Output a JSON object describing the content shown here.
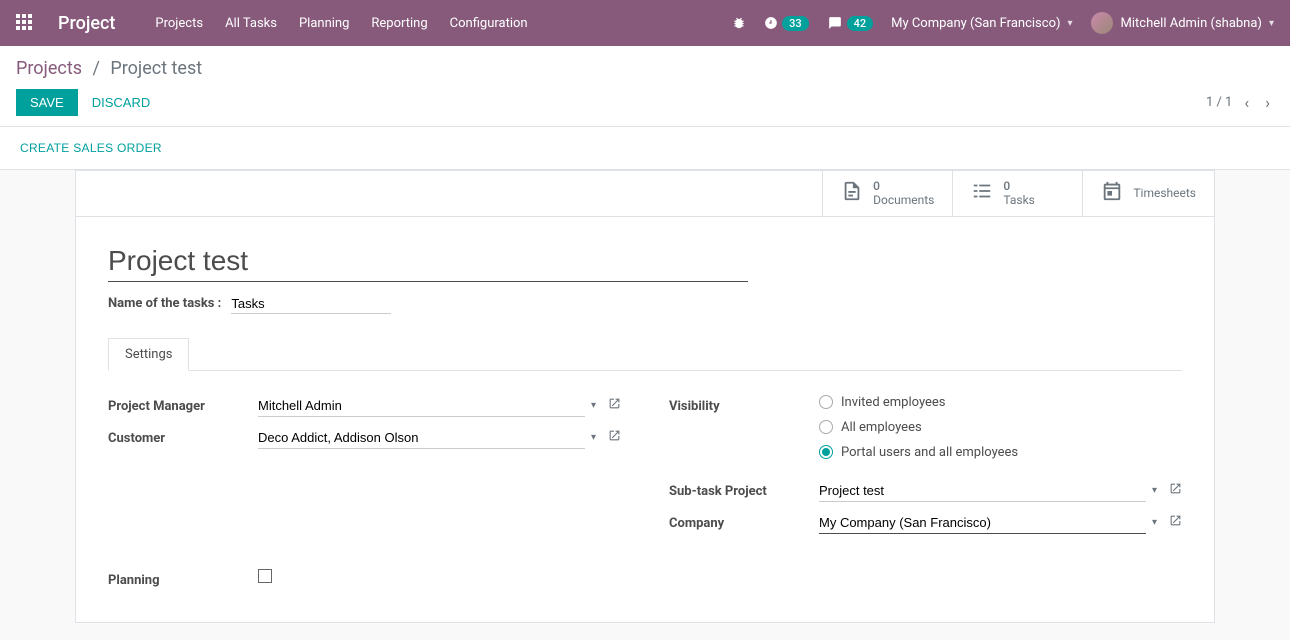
{
  "navbar": {
    "brand": "Project",
    "menu": [
      "Projects",
      "All Tasks",
      "Planning",
      "Reporting",
      "Configuration"
    ],
    "activities_badge": "33",
    "messages_badge": "42",
    "company": "My Company (San Francisco)",
    "user": "Mitchell Admin (shabna)"
  },
  "breadcrumb": {
    "root": "Projects",
    "current": "Project test"
  },
  "actions": {
    "save": "SAVE",
    "discard": "DISCARD",
    "pager": "1 / 1"
  },
  "statusbar": {
    "create_so": "CREATE SALES ORDER"
  },
  "stat_buttons": {
    "documents": {
      "count": "0",
      "label": "Documents"
    },
    "tasks": {
      "count": "0",
      "label": "Tasks"
    },
    "timesheets": {
      "label": "Timesheets"
    }
  },
  "form": {
    "title": "Project test",
    "tasks_label": "Name of the tasks :",
    "tasks_value": "Tasks",
    "tab_settings": "Settings",
    "labels": {
      "project_manager": "Project Manager",
      "customer": "Customer",
      "visibility": "Visibility",
      "subtask_project": "Sub-task Project",
      "company": "Company",
      "planning": "Planning"
    },
    "values": {
      "project_manager": "Mitchell Admin",
      "customer": "Deco Addict, Addison Olson",
      "subtask_project": "Project test",
      "company": "My Company (San Francisco)"
    },
    "visibility_options": {
      "invited": "Invited employees",
      "all": "All employees",
      "portal": "Portal users and all employees"
    }
  }
}
